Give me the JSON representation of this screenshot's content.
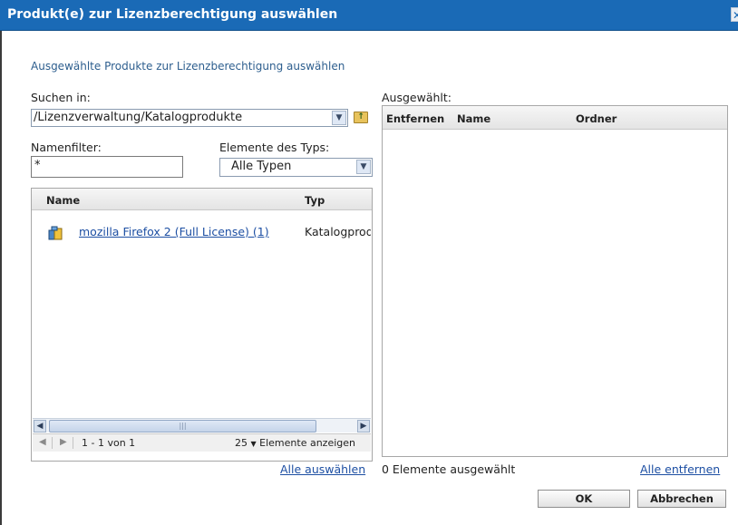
{
  "dialog": {
    "title": "Produkt(e) zur Lizenzberechtigung auswählen"
  },
  "description": "Ausgewählte Produkte zur Lizenzberechtigung auswählen",
  "search": {
    "label": "Suchen in:",
    "path": "/Lizenzverwaltung/Katalogprodukte"
  },
  "filter": {
    "name_label": "Namenfilter:",
    "name_value": "*",
    "type_label": "Elemente des Typs:",
    "type_value": "Alle Typen"
  },
  "results": {
    "columns": [
      "Name",
      "Typ"
    ],
    "rows": [
      {
        "name": "mozilla Firefox 2 (Full License) (1)",
        "type": "Katalogprodukt"
      }
    ],
    "pager": {
      "range": "1 - 1 von 1",
      "page_size": "25",
      "page_size_label": "Elemente anzeigen"
    },
    "select_all": "Alle auswählen"
  },
  "selected": {
    "label": "Ausgewählt:",
    "columns": [
      "Entfernen",
      "Name",
      "Ordner"
    ],
    "count_text": "0 Elemente ausgewählt",
    "remove_all": "Alle entfernen"
  },
  "buttons": {
    "ok": "OK",
    "cancel": "Abbrechen"
  },
  "icons": {
    "close": "close-icon",
    "folder_up": "folder-up-icon",
    "product": "product-box-icon"
  },
  "colors": {
    "titlebar": "#1a6ab6",
    "link": "#1d4fa3"
  }
}
